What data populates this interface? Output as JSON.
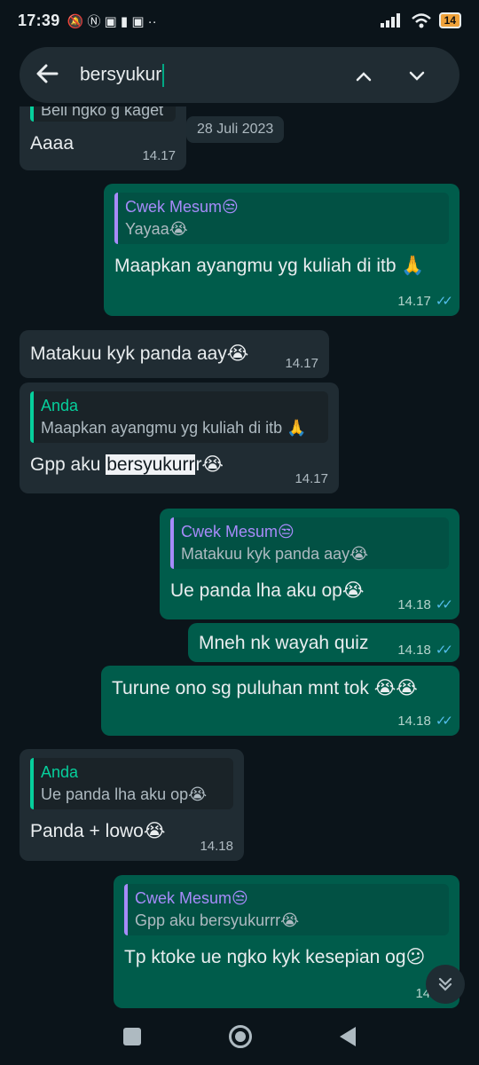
{
  "status": {
    "time": "17:39",
    "battery": "14",
    "left_icons": "🔕 Ⓝ ▣ ▮ ▣ ··"
  },
  "search": {
    "query": "bersyukur"
  },
  "date_chip": "28 Juli 2023",
  "messages": {
    "m0": {
      "quote_text": "Beli ngko g kaget",
      "text": "Aaaa",
      "time": "14.17"
    },
    "m1": {
      "quote_name": "Cwek Mesum😒",
      "quote_text": "Yayaa😭",
      "text": "Maapkan ayangmu yg kuliah di itb 🙏",
      "time": "14.17"
    },
    "m2": {
      "text": "Matakuu kyk panda aay😭",
      "time": "14.17"
    },
    "m3": {
      "quote_name": "Anda",
      "quote_text": "Maapkan ayangmu yg kuliah di itb 🙏",
      "text_before": "Gpp aku ",
      "text_highlight": "bersyukurr",
      "text_after": "r😭",
      "time": "14.17"
    },
    "m4": {
      "quote_name": "Cwek Mesum😒",
      "quote_text": "Matakuu kyk panda aay😭",
      "text": "Ue panda lha aku op😭",
      "time": "14.18"
    },
    "m5": {
      "text": "Mneh nk wayah quiz",
      "time": "14.18"
    },
    "m6": {
      "text": "Turune ono sg puluhan mnt tok 😭😭",
      "time": "14.18"
    },
    "m7": {
      "quote_name": "Anda",
      "quote_text": "Ue panda lha aku op😭",
      "text": "Panda + lowo😭",
      "time": "14.18"
    },
    "m8": {
      "quote_name": "Cwek Mesum😒",
      "quote_text": "Gpp aku bersyukurrr😭",
      "text": "Tp ktoke ue ngko kyk kesepian og😕",
      "time": "14.19"
    }
  },
  "ticks": "✓✓",
  "icons": {
    "back": "arrow-left",
    "up": "chevron-up",
    "down": "chevron-down",
    "scroll": "double-chevron-down"
  }
}
